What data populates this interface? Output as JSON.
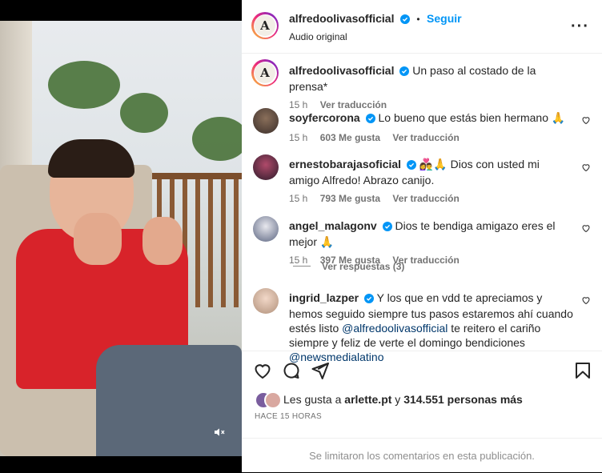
{
  "post": {
    "username": "alfredoolivasofficial",
    "dot": "•",
    "follow_label": "Seguir",
    "audio": "Audio original",
    "more_icon": "more-horizontal-icon",
    "avatar_letter": "A",
    "caption": "Un paso al costado de la prensa*",
    "caption_time": "15 h",
    "see_translation": "Ver traducción"
  },
  "comments": [
    {
      "username": "soyfercorona",
      "text": "Lo bueno que estás bien hermano 🙏",
      "time": "15 h",
      "likes": "603 Me gusta",
      "translate": "Ver traducción"
    },
    {
      "username": "ernestobarajasoficial",
      "text": "👩‍❤️‍👨🙏 Dios con usted mi amigo Alfredo! Abrazo canijo.",
      "time": "15 h",
      "likes": "793 Me gusta",
      "translate": "Ver traducción"
    },
    {
      "username": "angel_malagonv",
      "text": "Dios te bendiga amigazo eres el mejor 🙏",
      "time": "15 h",
      "likes": "397 Me gusta",
      "translate": "Ver traducción"
    },
    {
      "username": "ingrid_lazper",
      "text_before": "Y los que en vdd te apreciamos y hemos seguido siempre tus pasos estaremos ahí cuando estés listo ",
      "mention1": "@alfredoolivasofficial",
      "text_middle": " te reitero el cariño siempre y feliz de verte el domingo bendiciones ",
      "mention2": "@newsmedialatino"
    }
  ],
  "view_replies": "Ver respuestas (3)",
  "likes": {
    "prefix": "Les gusta a ",
    "user": "arlette.pt",
    "middle": " y ",
    "count": "314.551 personas más"
  },
  "posted": "HACE 15 HORAS",
  "limited": "Se limitaron los comentarios en esta publicación.",
  "colors": {
    "accent": "#0095f6",
    "verified": "#0095f6",
    "mention": "#00376b",
    "shirt": "#d8232a"
  }
}
